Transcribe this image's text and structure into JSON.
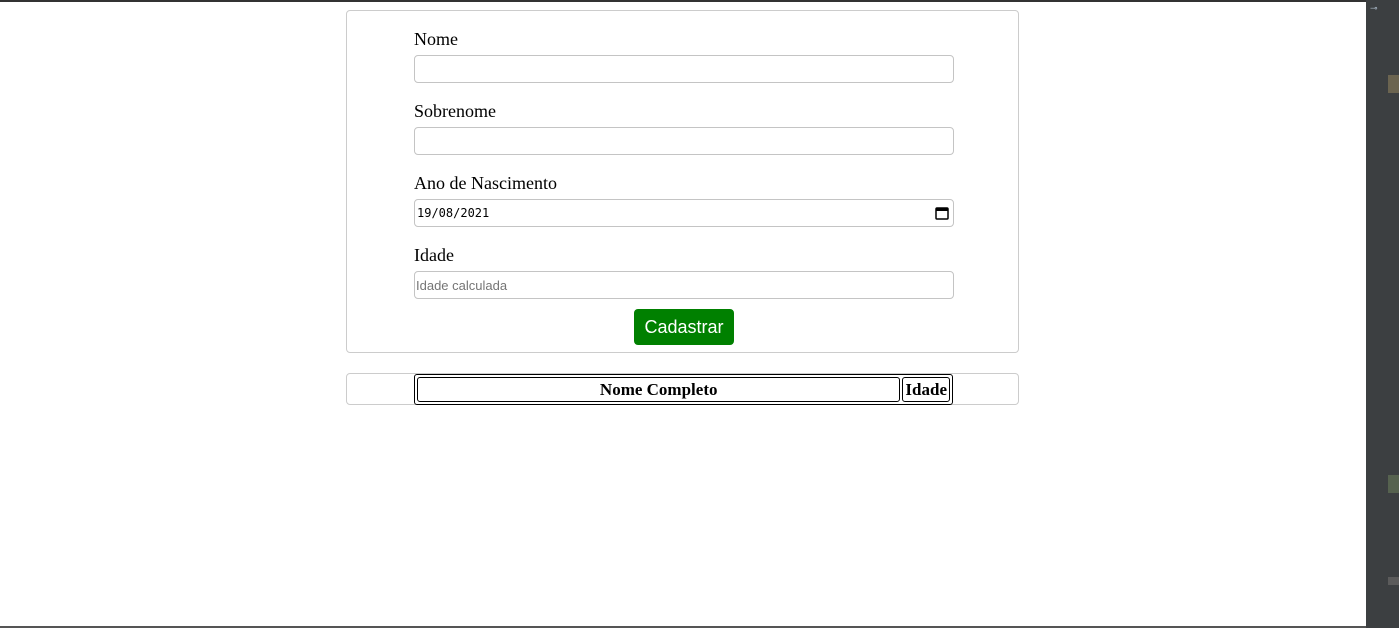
{
  "form": {
    "nome_label": "Nome",
    "nome_value": "",
    "sobrenome_label": "Sobrenome",
    "sobrenome_value": "",
    "nascimento_label": "Ano de Nascimento",
    "nascimento_value": "19/08/2021",
    "idade_label": "Idade",
    "idade_placeholder": "Idade calculada",
    "submit_label": "Cadastrar"
  },
  "table": {
    "headers": [
      "Nome Completo",
      "Idade"
    ],
    "rows": []
  },
  "colors": {
    "submit_bg": "#008000",
    "border": "#cccccc"
  }
}
